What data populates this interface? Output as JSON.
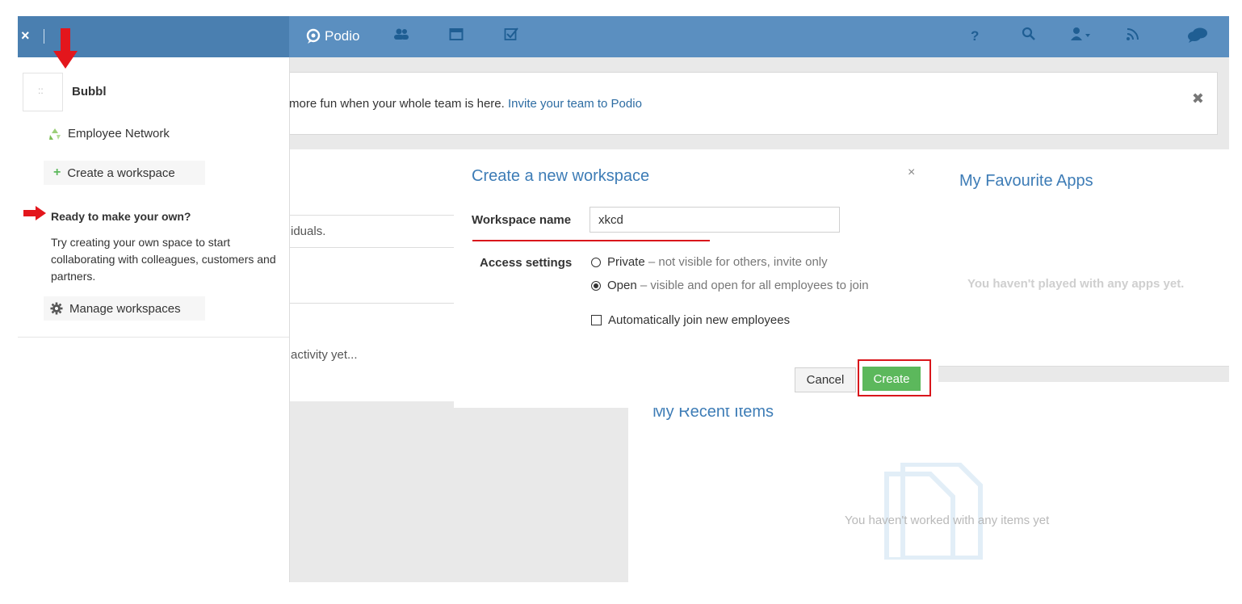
{
  "topbar": {
    "close_label": "×",
    "logo_text": "Podio",
    "nav_icons": [
      "contacts-icon",
      "calendar-icon",
      "tasks-icon"
    ],
    "right_icons": [
      "help-icon",
      "search-icon",
      "user-icon",
      "feed-icon",
      "chat-icon"
    ],
    "help_glyph": "?"
  },
  "sidebar": {
    "workspace_thumb": "::",
    "workspace_name": "Bubbl",
    "employee_network": "Employee Network",
    "create_workspace": "Create a workspace",
    "ready_title": "Ready to make your own?",
    "ready_text": "Try creating your own space to start collaborating with colleagues, customers and partners.",
    "manage_workspaces": "Manage workspaces"
  },
  "main": {
    "invite_text": "more fun when your whole team is here.",
    "invite_link": "Invite your team to Podio",
    "left_card_text1": "iduals.",
    "left_card_text2": "activity yet...",
    "fav_title": "My Favourite Apps",
    "fav_empty": "You haven't played with any apps yet.",
    "recent_title": "My Recent Items",
    "recent_empty": "You haven't worked with any items yet"
  },
  "modal": {
    "title": "Create a new workspace",
    "close": "×",
    "name_label": "Workspace name",
    "name_value": "xkcd",
    "access_label": "Access settings",
    "private_label": "Private",
    "private_desc": "– not visible for others, invite only",
    "open_label": "Open",
    "open_desc": "– visible and open for all employees to join",
    "auto_join": "Automatically join new employees",
    "cancel": "Cancel",
    "create": "Create",
    "selected_access": "Open"
  },
  "colors": {
    "topbar": "#5b8fc0",
    "accent_blue": "#3d7cb6",
    "create_green": "#5cb85c",
    "annotation_red": "#d9161c"
  }
}
